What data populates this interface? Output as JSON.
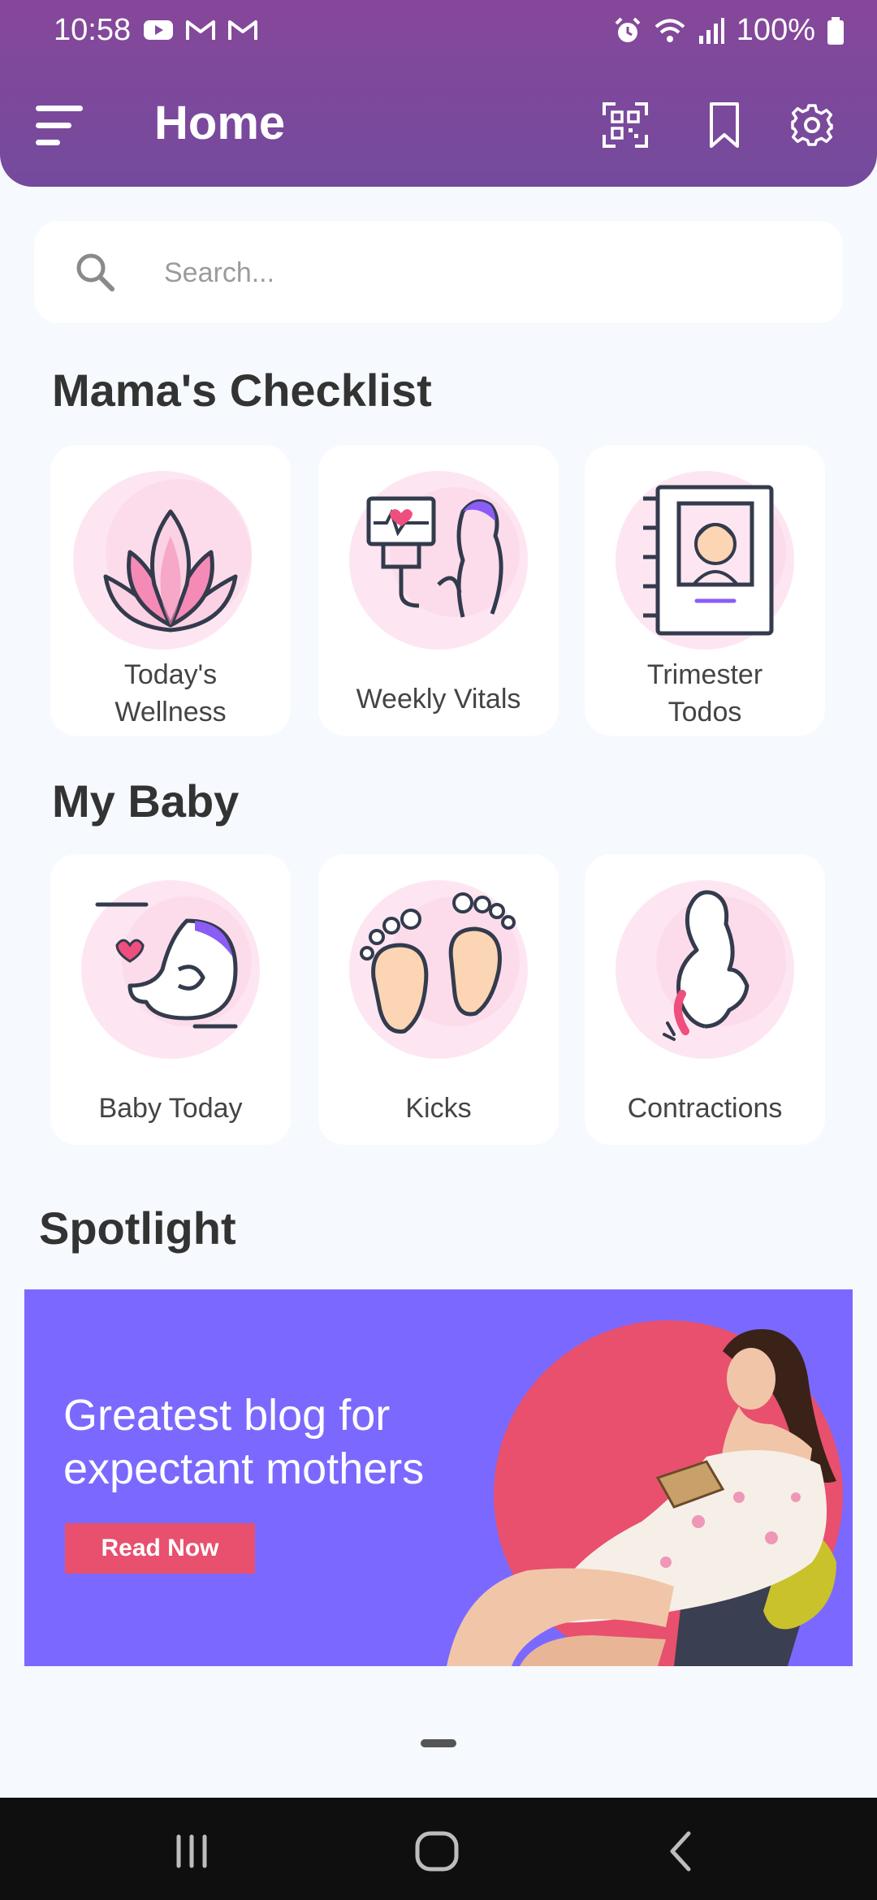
{
  "status_bar": {
    "time": "10:58",
    "battery": "100%",
    "icons": [
      "youtube-icon",
      "gmail-icon",
      "gmail-icon",
      "alarm-icon",
      "wifi-icon",
      "signal-icon",
      "battery-icon"
    ]
  },
  "header": {
    "title": "Home",
    "icons": [
      "menu-icon",
      "qr-scan-icon",
      "bookmark-icon",
      "gear-icon"
    ]
  },
  "search": {
    "placeholder": "Search..."
  },
  "checklist": {
    "title": "Mama's Checklist",
    "items": [
      {
        "label": "Today's Wellness",
        "line1": "Today's",
        "line2": "Wellness",
        "icon": "lotus-icon"
      },
      {
        "label": "Weekly Vitals",
        "icon": "ultrasound-icon"
      },
      {
        "label": "Trimester Todos",
        "line1": "Trimester",
        "line2": "Todos",
        "icon": "baby-book-icon"
      }
    ]
  },
  "my_baby": {
    "title": "My Baby",
    "items": [
      {
        "label": "Baby Today",
        "icon": "fetus-icon"
      },
      {
        "label": "Kicks",
        "icon": "baby-feet-icon"
      },
      {
        "label": "Contractions",
        "icon": "pregnant-woman-icon"
      }
    ]
  },
  "spotlight": {
    "title": "Spotlight",
    "headline": "Greatest blog for expectant mothers",
    "button": "Read Now",
    "colors": {
      "background": "#7b69ff",
      "accent": "#e8506e"
    }
  },
  "colors": {
    "header": "#804a9c",
    "background": "#f6f9fd"
  }
}
